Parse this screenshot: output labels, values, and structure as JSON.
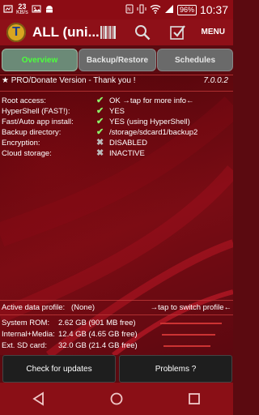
{
  "status_bar": {
    "speed_value": "23",
    "speed_unit": "KB/s",
    "battery": "96%",
    "time": "10:37"
  },
  "action_bar": {
    "logo_letter": "T",
    "title": "ALL (uni...",
    "menu_label": "MENU"
  },
  "tabs": [
    {
      "label": "Overview",
      "active": true
    },
    {
      "label": "Backup/Restore",
      "active": false
    },
    {
      "label": "Schedules",
      "active": false
    }
  ],
  "pro_banner": {
    "text": "★ PRO/Donate Version - Thank you !",
    "version": "7.0.0.2"
  },
  "info": [
    {
      "label": "Root access:",
      "icon": "check-icon",
      "value": "OK →tap for more info←"
    },
    {
      "label": "HyperShell (FAST!):",
      "icon": "check-icon",
      "value": "YES"
    },
    {
      "label": "Fast/Auto app install:",
      "icon": "check-icon",
      "value": "YES (using HyperShell)"
    },
    {
      "label": "Backup directory:",
      "icon": "check-icon",
      "value": "/storage/sdcard1/backup2"
    },
    {
      "label": "Encryption:",
      "icon": "cross-icon",
      "value": "DISABLED"
    },
    {
      "label": "Cloud storage:",
      "icon": "cross-icon",
      "value": "INACTIVE"
    }
  ],
  "profile": {
    "label": "Active data profile:",
    "value": "(None)",
    "action": "→tap to switch profile←"
  },
  "storage": [
    {
      "label": "System ROM:",
      "value": "2.62 GB (901 MB free)"
    },
    {
      "label": "Internal+Media:",
      "value": "12.4 GB (4.65 GB free)"
    },
    {
      "label": "Ext. SD card:",
      "value": "32.0 GB (21.4 GB free)"
    }
  ],
  "buttons": {
    "check_updates": "Check for updates",
    "problems": "Problems ?"
  },
  "colors": {
    "accent_green": "#4cff3c",
    "status_bar": "#8c0c14",
    "background": "#5b0a10"
  }
}
